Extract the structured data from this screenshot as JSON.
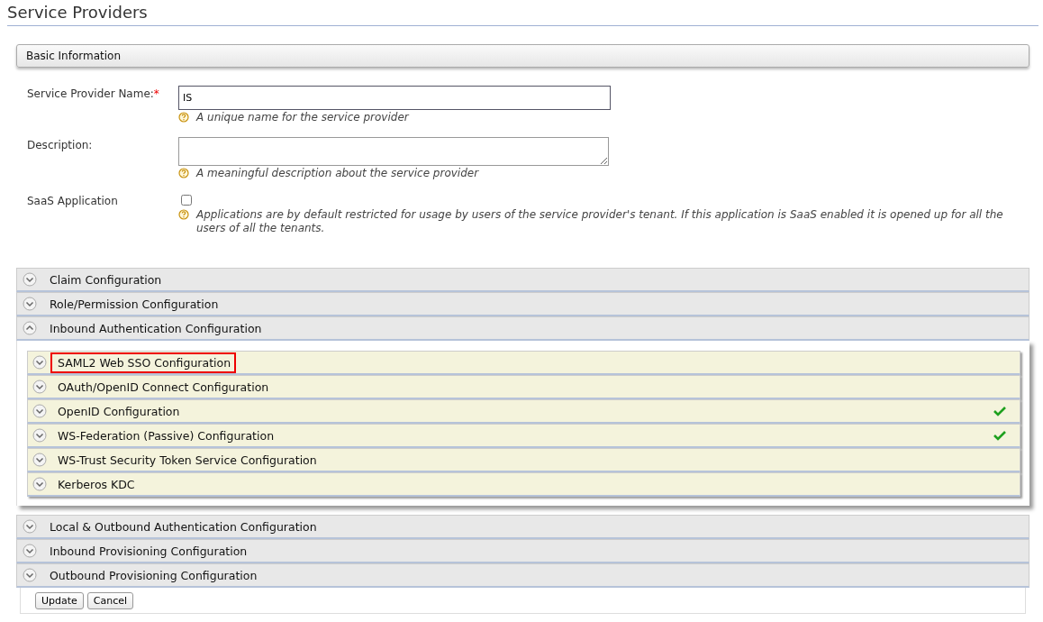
{
  "page_title": "Service Providers",
  "basic_information": {
    "title": "Basic Information",
    "fields": [
      {
        "kind": "text",
        "label": "Service Provider Name:",
        "required_mark": "*",
        "value": "IS",
        "help": "A unique name for the service provider"
      },
      {
        "kind": "textarea",
        "label": "Description:",
        "help": "A meaningful description about the service provider"
      },
      {
        "kind": "checkbox",
        "label": "SaaS Application",
        "checked": false,
        "help": "Applications are by default restricted for usage by users of the service provider's tenant. If this application is SaaS enabled it is opened up for all the users of all the tenants."
      }
    ]
  },
  "sections": [
    {
      "title": "Claim Configuration",
      "expanded": false
    },
    {
      "title": "Role/Permission Configuration",
      "expanded": false
    },
    {
      "title": "Inbound Authentication Configuration",
      "expanded": true,
      "children": [
        {
          "title": "SAML2 Web SSO Configuration",
          "configured": false,
          "highlighted": true
        },
        {
          "title": "OAuth/OpenID Connect Configuration",
          "configured": false,
          "highlighted": false
        },
        {
          "title": "OpenID Configuration",
          "configured": true,
          "highlighted": false
        },
        {
          "title": "WS-Federation (Passive) Configuration",
          "configured": true,
          "highlighted": false
        },
        {
          "title": "WS-Trust Security Token Service Configuration",
          "configured": false,
          "highlighted": false
        },
        {
          "title": "Kerberos KDC",
          "configured": false,
          "highlighted": false
        }
      ]
    },
    {
      "title": "Local & Outbound Authentication Configuration",
      "expanded": false
    },
    {
      "title": "Inbound Provisioning Configuration",
      "expanded": false
    },
    {
      "title": "Outbound Provisioning Configuration",
      "expanded": false
    }
  ],
  "buttons": [
    "Update",
    "Cancel"
  ]
}
